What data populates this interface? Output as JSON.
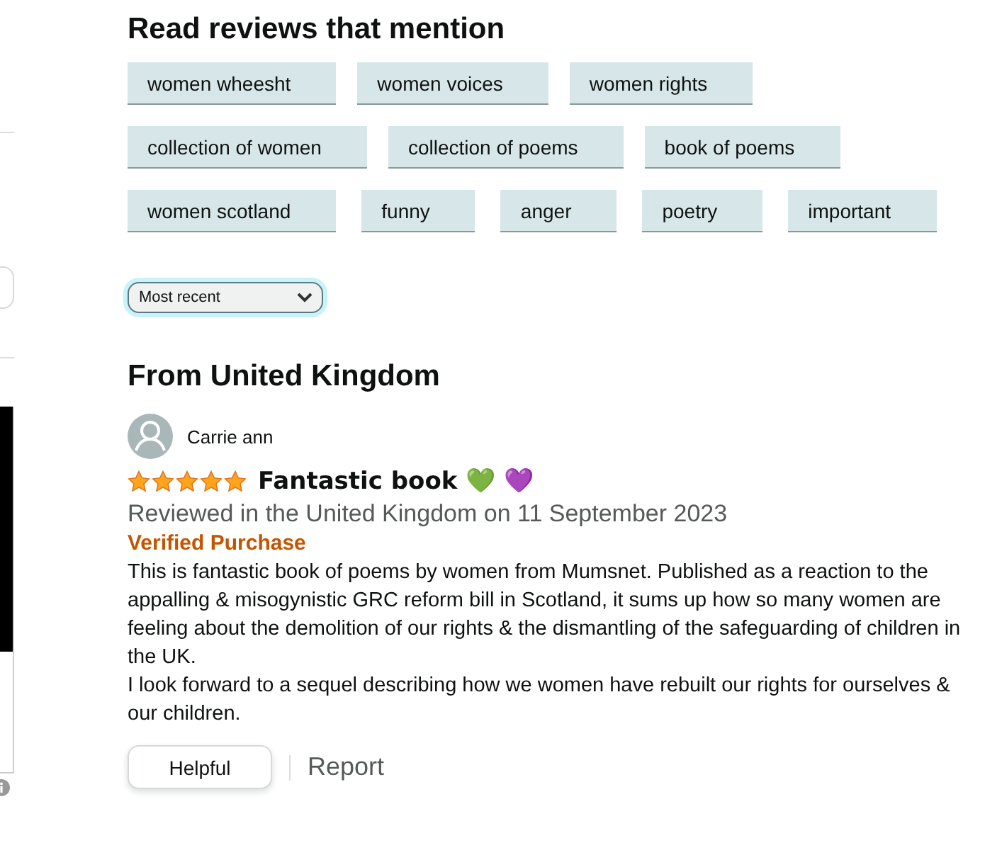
{
  "mentions": {
    "title": "Read reviews that mention",
    "rows": [
      [
        "women wheesht",
        "women voices",
        "women rights"
      ],
      [
        "collection of women",
        "collection of poems",
        "book of poems"
      ],
      [
        "women scotland",
        "funny",
        "anger",
        "poetry",
        "important"
      ]
    ]
  },
  "sort": {
    "value": "Most recent"
  },
  "section_title": "From United Kingdom",
  "review": {
    "author": "Carrie ann",
    "stars": 5,
    "title": "Fantastic book 💚  💜",
    "meta": "Reviewed in the United Kingdom on 11 September 2023",
    "badge": "Verified Purchase",
    "paragraphs": [
      "This is fantastic book of poems by women from Mumsnet. Published as a reaction to the appalling & misogynistic GRC reform bill in Scotland, it sums up how so many women are feeling about the demolition of our rights & the dismantling of the safeguarding of children in the UK.",
      "I look forward to a sequel describing how we women have rebuilt our rights for ourselves & our children."
    ],
    "helpful": "Helpful",
    "report": "Report"
  }
}
